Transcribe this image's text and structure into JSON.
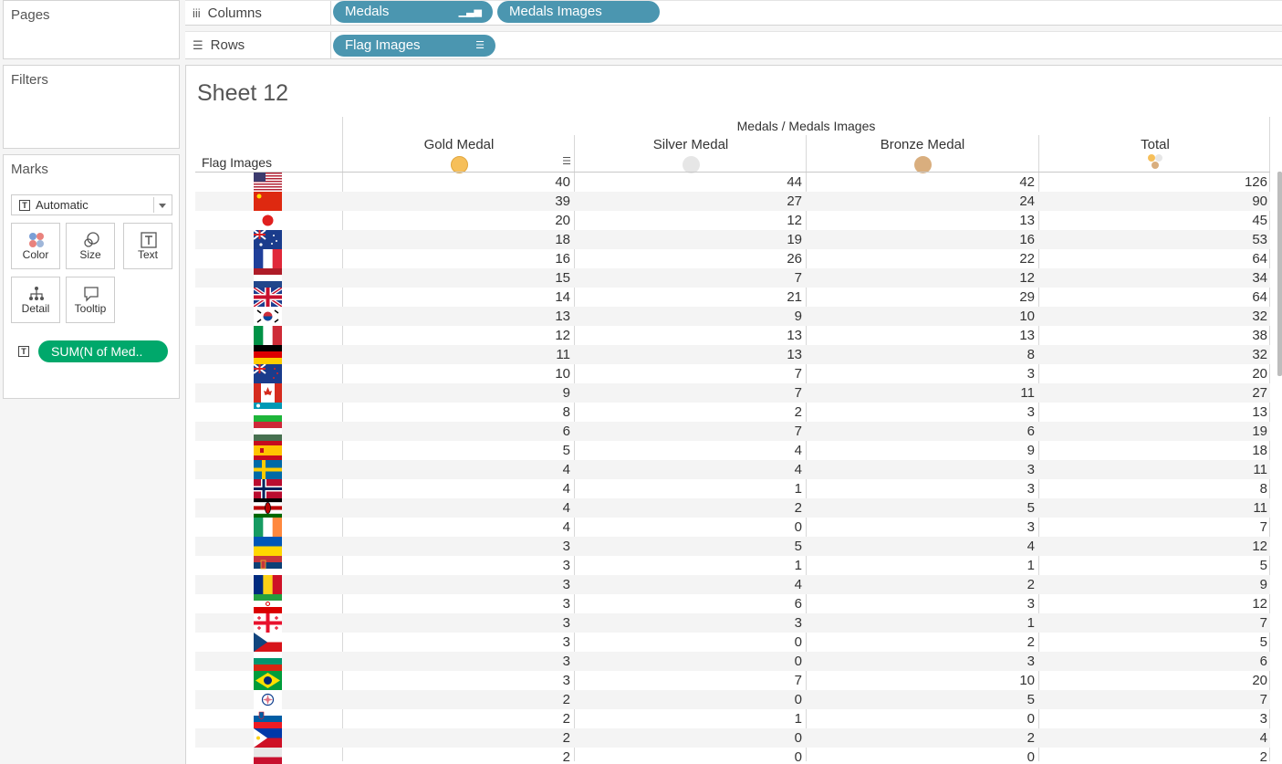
{
  "left_panel": {
    "pages_title": "Pages",
    "filters_title": "Filters",
    "marks_title": "Marks",
    "mark_type": "Automatic",
    "buttons": {
      "color": "Color",
      "size": "Size",
      "text": "Text",
      "detail": "Detail",
      "tooltip": "Tooltip"
    },
    "text_pill": "SUM(N of Med.."
  },
  "shelves": {
    "columns_label": "Columns",
    "columns_pills": [
      "Medals",
      "Medals Images"
    ],
    "rows_label": "Rows",
    "rows_pills": [
      "Flag Images"
    ]
  },
  "sheet": {
    "title": "Sheet 12",
    "column_group": "Medals / Medals Images",
    "row_header": "Flag Images",
    "columns": [
      "Gold Medal",
      "Silver Medal",
      "Bronze Medal",
      "Total"
    ],
    "colors": {
      "gold": "#f6bf5a",
      "silver": "#e6e6e6",
      "bronze": "#d9ae7e",
      "pill_blue": "#4b96b0",
      "pill_green": "#00a86b"
    }
  },
  "rows": [
    {
      "flag": "usa-flag",
      "gold": "40",
      "silver": "44",
      "bronze": "42",
      "total": "126"
    },
    {
      "flag": "china-flag",
      "gold": "39",
      "silver": "27",
      "bronze": "24",
      "total": "90"
    },
    {
      "flag": "japan-flag",
      "gold": "20",
      "silver": "12",
      "bronze": "13",
      "total": "45"
    },
    {
      "flag": "australia-flag",
      "gold": "18",
      "silver": "19",
      "bronze": "16",
      "total": "53"
    },
    {
      "flag": "france-flag",
      "gold": "16",
      "silver": "26",
      "bronze": "22",
      "total": "64"
    },
    {
      "flag": "netherlands-flag",
      "gold": "15",
      "silver": "7",
      "bronze": "12",
      "total": "34"
    },
    {
      "flag": "uk-flag",
      "gold": "14",
      "silver": "21",
      "bronze": "29",
      "total": "64"
    },
    {
      "flag": "south-korea-flag",
      "gold": "13",
      "silver": "9",
      "bronze": "10",
      "total": "32"
    },
    {
      "flag": "italy-flag",
      "gold": "12",
      "silver": "13",
      "bronze": "13",
      "total": "38"
    },
    {
      "flag": "germany-flag",
      "gold": "11",
      "silver": "13",
      "bronze": "8",
      "total": "32"
    },
    {
      "flag": "new-zealand-flag",
      "gold": "10",
      "silver": "7",
      "bronze": "3",
      "total": "20"
    },
    {
      "flag": "canada-flag",
      "gold": "9",
      "silver": "7",
      "bronze": "11",
      "total": "27"
    },
    {
      "flag": "uzbekistan-flag",
      "gold": "8",
      "silver": "2",
      "bronze": "3",
      "total": "13"
    },
    {
      "flag": "hungary-flag",
      "gold": "6",
      "silver": "7",
      "bronze": "6",
      "total": "19"
    },
    {
      "flag": "spain-flag",
      "gold": "5",
      "silver": "4",
      "bronze": "9",
      "total": "18"
    },
    {
      "flag": "sweden-flag",
      "gold": "4",
      "silver": "4",
      "bronze": "3",
      "total": "11"
    },
    {
      "flag": "norway-flag",
      "gold": "4",
      "silver": "1",
      "bronze": "3",
      "total": "8"
    },
    {
      "flag": "kenya-flag",
      "gold": "4",
      "silver": "2",
      "bronze": "5",
      "total": "11"
    },
    {
      "flag": "ireland-flag",
      "gold": "4",
      "silver": "0",
      "bronze": "3",
      "total": "7"
    },
    {
      "flag": "ukraine-flag",
      "gold": "3",
      "silver": "5",
      "bronze": "4",
      "total": "12"
    },
    {
      "flag": "serbia-flag",
      "gold": "3",
      "silver": "1",
      "bronze": "1",
      "total": "5"
    },
    {
      "flag": "romania-flag",
      "gold": "3",
      "silver": "4",
      "bronze": "2",
      "total": "9"
    },
    {
      "flag": "iran-flag",
      "gold": "3",
      "silver": "6",
      "bronze": "3",
      "total": "12"
    },
    {
      "flag": "georgia-flag",
      "gold": "3",
      "silver": "3",
      "bronze": "1",
      "total": "7"
    },
    {
      "flag": "czechia-flag",
      "gold": "3",
      "silver": "0",
      "bronze": "2",
      "total": "5"
    },
    {
      "flag": "bulgaria-flag",
      "gold": "3",
      "silver": "0",
      "bronze": "3",
      "total": "6"
    },
    {
      "flag": "brazil-flag",
      "gold": "3",
      "silver": "7",
      "bronze": "10",
      "total": "20"
    },
    {
      "flag": "taiwan-flag",
      "gold": "2",
      "silver": "0",
      "bronze": "5",
      "total": "7"
    },
    {
      "flag": "slovenia-flag",
      "gold": "2",
      "silver": "1",
      "bronze": "0",
      "total": "3"
    },
    {
      "flag": "philippines-flag",
      "gold": "2",
      "silver": "0",
      "bronze": "2",
      "total": "4"
    },
    {
      "flag": "generic-flag",
      "gold": "2",
      "silver": "0",
      "bronze": "0",
      "total": "2"
    }
  ]
}
